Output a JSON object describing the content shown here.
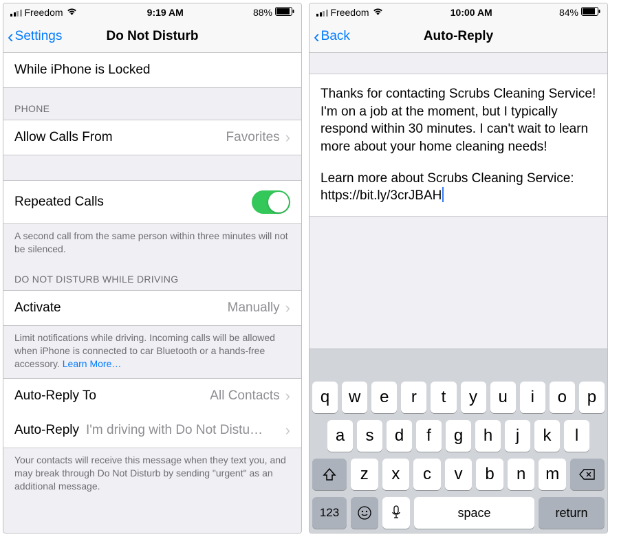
{
  "left": {
    "status": {
      "carrier": "Freedom",
      "time": "9:19 AM",
      "battery": "88%"
    },
    "nav": {
      "back": "Settings",
      "title": "Do Not Disturb"
    },
    "rows": {
      "while_locked": "While iPhone is Locked",
      "phone_header": "Phone",
      "allow_calls_label": "Allow Calls From",
      "allow_calls_value": "Favorites",
      "repeated_label": "Repeated Calls",
      "repeated_footer": "A second call from the same person within three minutes will not be silenced.",
      "driving_header": "Do Not Disturb While Driving",
      "activate_label": "Activate",
      "activate_value": "Manually",
      "activate_footer_text": "Limit notifications while driving. Incoming calls will be allowed when iPhone is connected to car Bluetooth or a hands-free accessory. ",
      "activate_footer_link": "Learn More…",
      "autoreply_to_label": "Auto-Reply To",
      "autoreply_to_value": "All Contacts",
      "autoreply_label": "Auto-Reply",
      "autoreply_value": "I'm driving with Do Not Distu…",
      "autoreply_footer": "Your contacts will receive this message when they text you, and may break through Do Not Disturb by sending \"urgent\" as an additional message."
    }
  },
  "right": {
    "status": {
      "carrier": "Freedom",
      "time": "10:00 AM",
      "battery": "84%"
    },
    "nav": {
      "back": "Back",
      "title": "Auto-Reply"
    },
    "editor": {
      "para1": "Thanks for contacting Scrubs Cleaning Service! I'm on a job at the moment, but I typically respond within 30 minutes. I can't wait to learn more about your home cleaning needs!",
      "para2a": "Learn more about Scrubs Cleaning Service: ",
      "para2b": "https://bit.ly/3crJBAH"
    },
    "keyboard": {
      "row1": [
        "q",
        "w",
        "e",
        "r",
        "t",
        "y",
        "u",
        "i",
        "o",
        "p"
      ],
      "row2": [
        "a",
        "s",
        "d",
        "f",
        "g",
        "h",
        "j",
        "k",
        "l"
      ],
      "row3": [
        "z",
        "x",
        "c",
        "v",
        "b",
        "n",
        "m"
      ],
      "mode": "123",
      "space": "space",
      "return": "return"
    }
  }
}
